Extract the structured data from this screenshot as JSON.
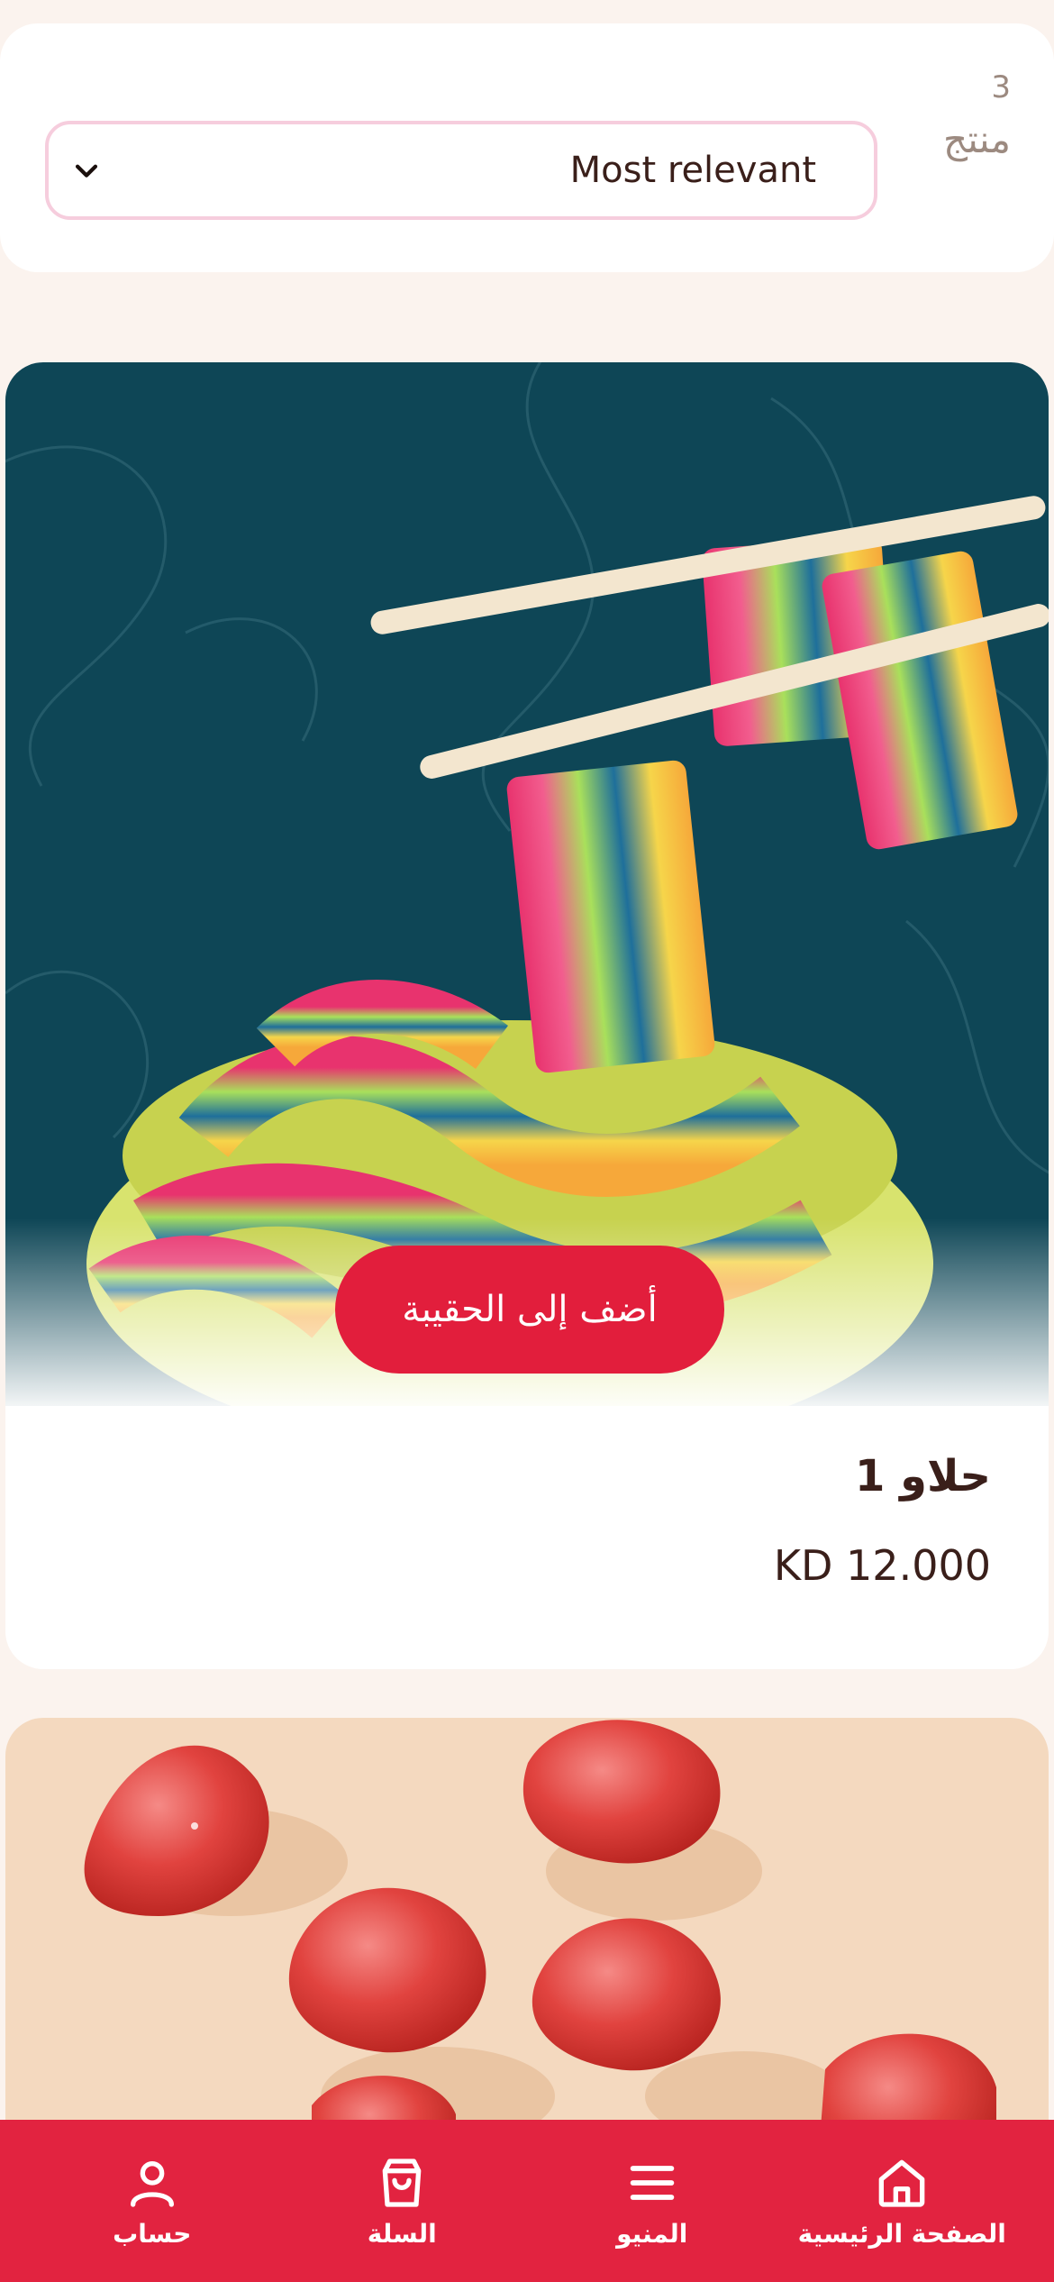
{
  "results": {
    "count": "3",
    "count_label": "منتج"
  },
  "sort": {
    "selected": "Most relevant"
  },
  "products": [
    {
      "name": "حلاو 1",
      "price": "KD 12.000",
      "add_label": "أضف إلى الحقيبة"
    }
  ],
  "nav": {
    "items": [
      {
        "label": "الصفحة الرئيسية",
        "icon": "home-icon"
      },
      {
        "label": "المنيو",
        "icon": "menu-icon"
      },
      {
        "label": "السلة",
        "icon": "bag-icon"
      },
      {
        "label": "حساب",
        "icon": "user-icon"
      }
    ]
  },
  "colors": {
    "accent": "#e21e3c",
    "nav_bg": "#e22340",
    "text_dark": "#3a1f1a",
    "muted": "#9c8a80",
    "page_bg": "#fbf3ee",
    "select_border": "#f6cddd"
  }
}
